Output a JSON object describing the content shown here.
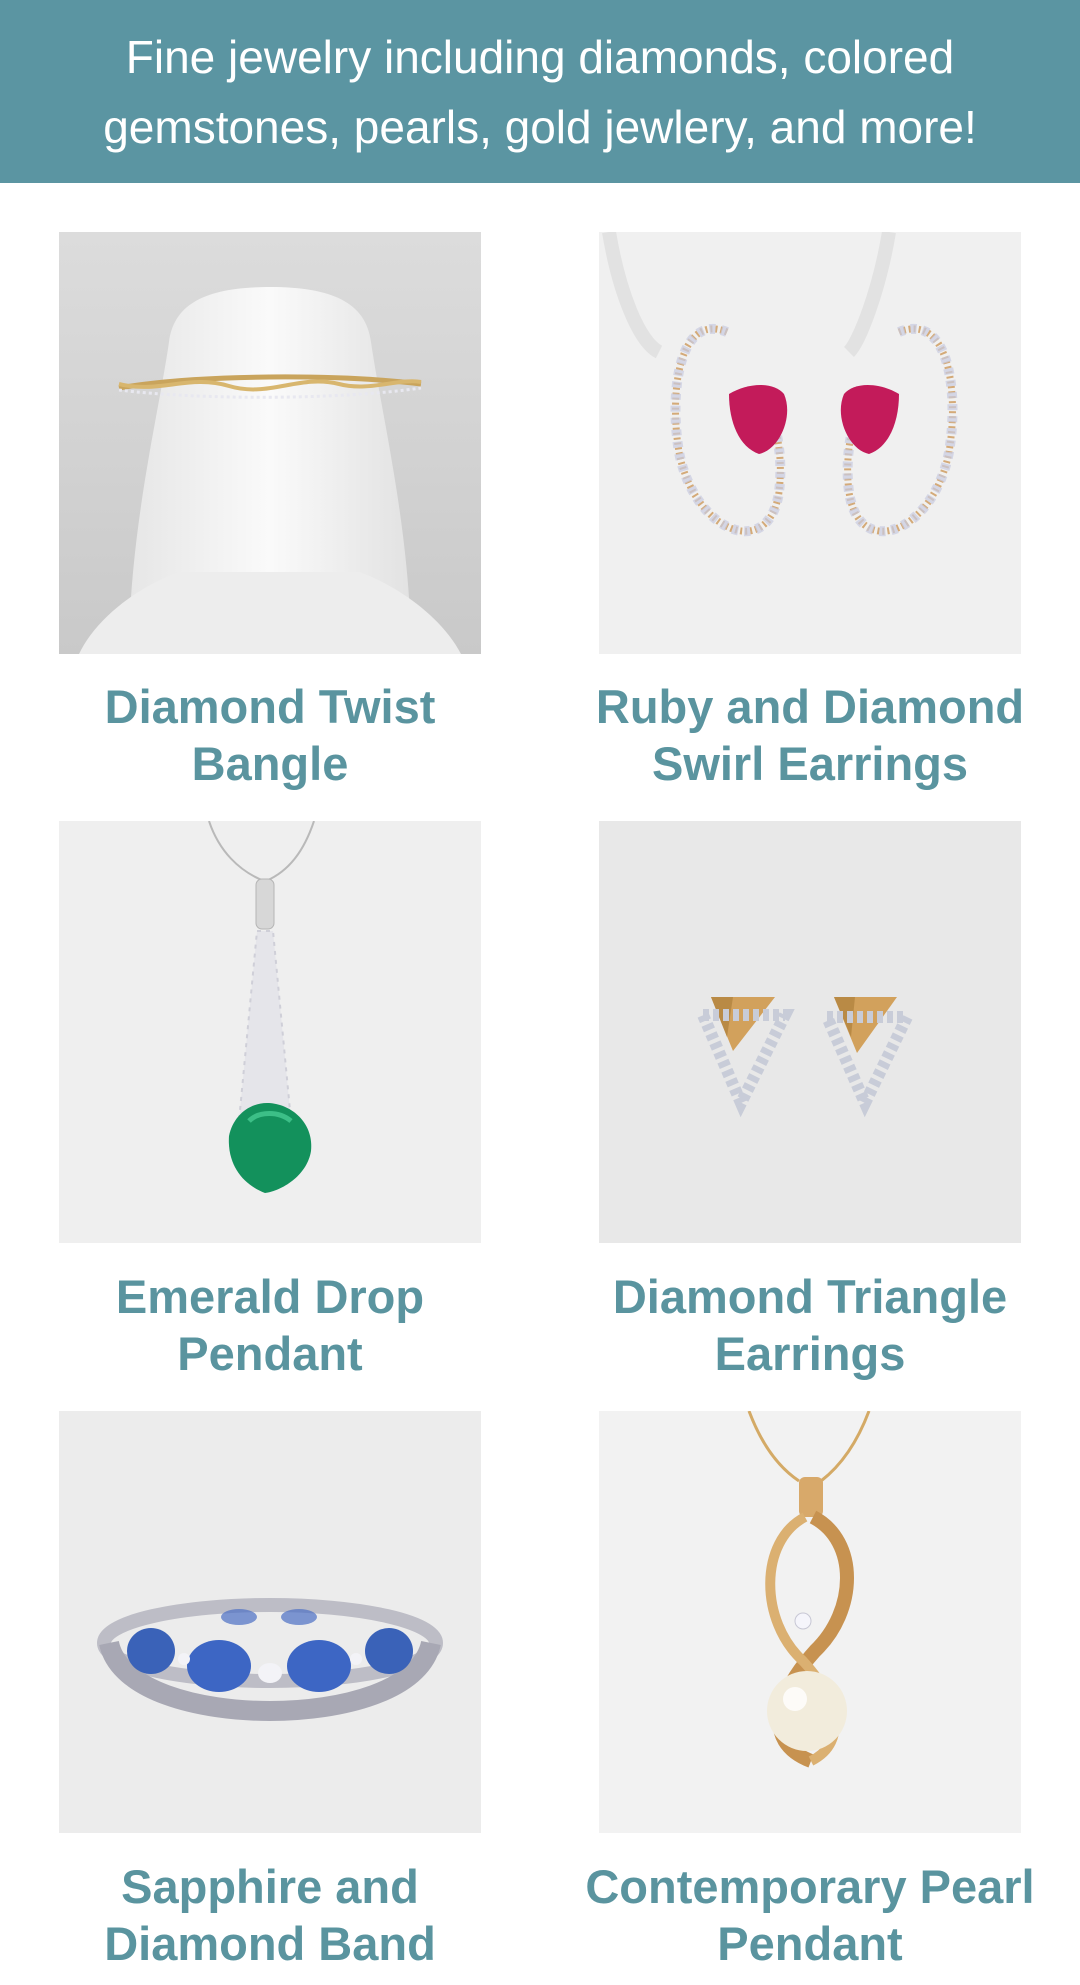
{
  "banner": {
    "text": "Fine jewelry including diamonds, colored gemstones, pearls, gold jewlery, and more!"
  },
  "colors": {
    "banner_bg": "#5b95a2",
    "title_text": "#5a949f"
  },
  "products": [
    {
      "title_line1": "Diamond Twist",
      "title_line2": "Bangle",
      "image_icon": "bangle-image"
    },
    {
      "title_line1": "Ruby and Diamond",
      "title_line2": "Swirl Earrings",
      "image_icon": "earrings-image"
    },
    {
      "title_line1": "Emerald Drop",
      "title_line2": "Pendant",
      "image_icon": "pendant-image"
    },
    {
      "title_line1": "Diamond Triangle",
      "title_line2": "Earrings",
      "image_icon": "earrings-image"
    },
    {
      "title_line1": "Sapphire and",
      "title_line2": "Diamond Band",
      "image_icon": "ring-image"
    },
    {
      "title_line1": "Contemporary Pearl",
      "title_line2": "Pendant",
      "image_icon": "pendant-image"
    }
  ]
}
